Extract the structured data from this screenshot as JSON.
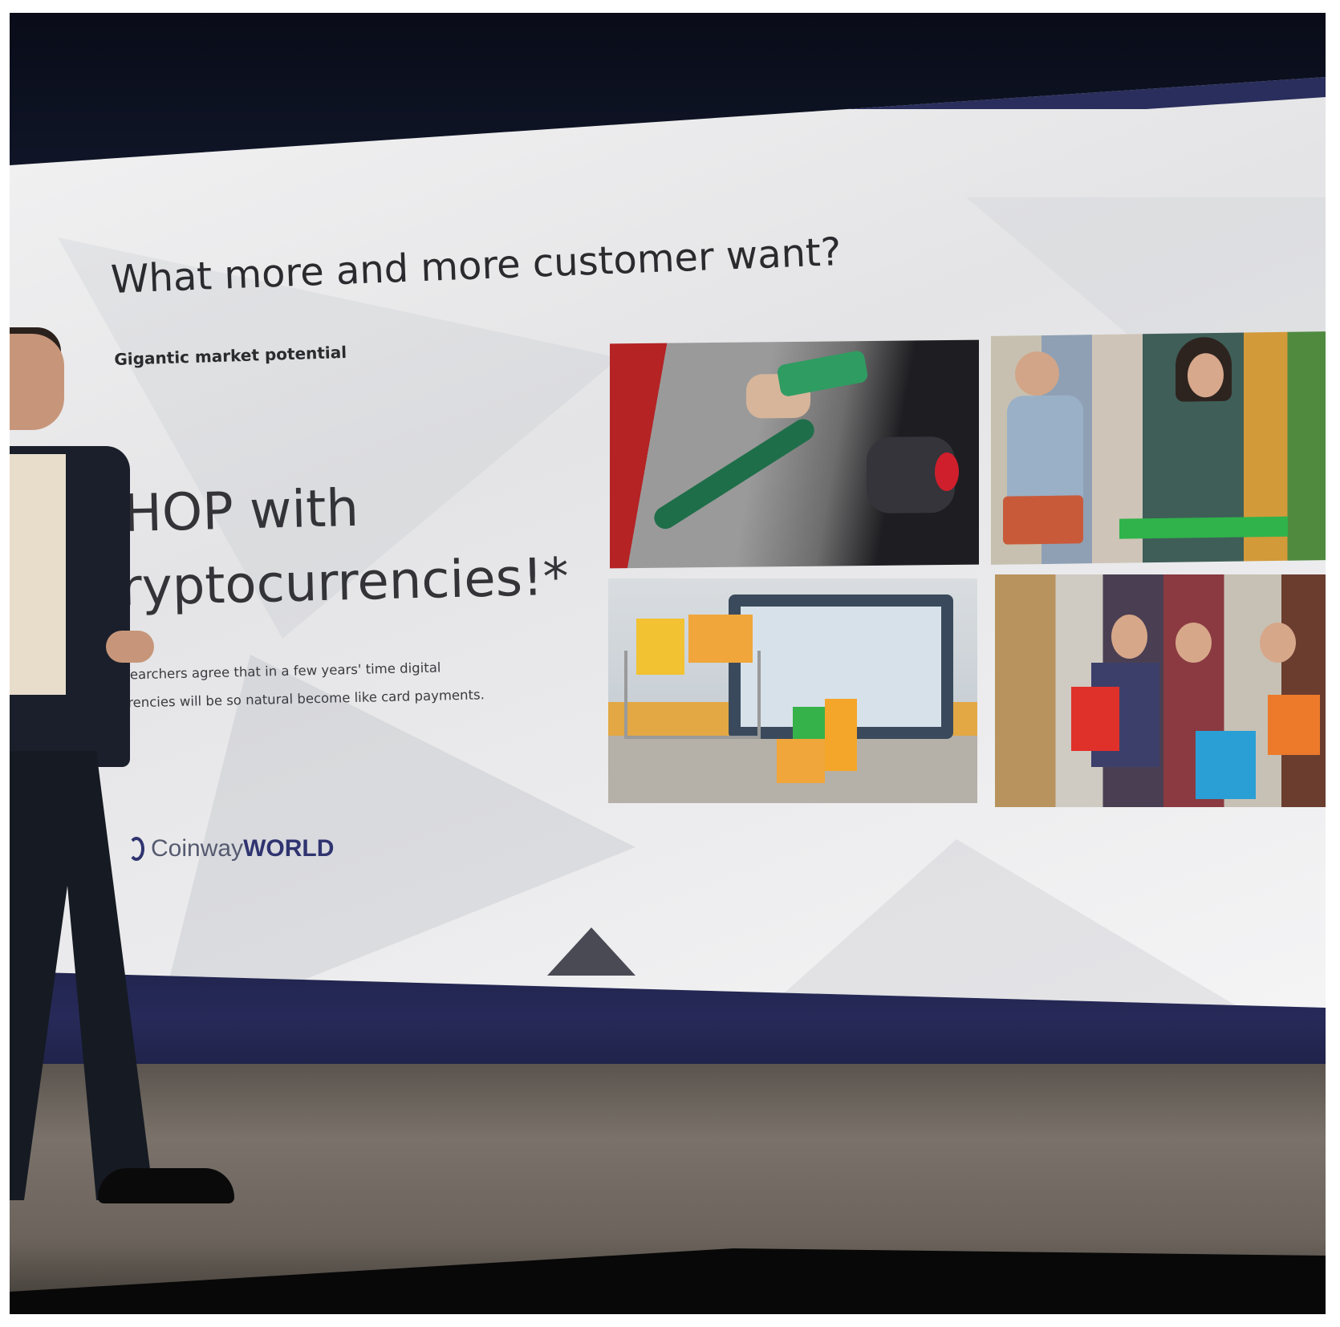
{
  "slide": {
    "title": "What more and more customer want?",
    "subtitle": "Gigantic market potential",
    "headline_line1": "SHOP with",
    "headline_line2": "cryptocurrencies!*",
    "body_line1": "Researchers agree that in a few years' time digital",
    "body_line2": "currencies will be so natural become like card payments.",
    "logo_part1": "Coinway",
    "logo_part2": "WORLD"
  },
  "images": [
    {
      "label": "fuel-pump-photo"
    },
    {
      "label": "grocery-shopping-photo"
    },
    {
      "label": "online-shopping-cart-photo"
    },
    {
      "label": "women-shopping-bags-photo"
    }
  ],
  "colors": {
    "screen_bg": "#ececee",
    "text": "#2b2b2f",
    "brand": "#2f3470",
    "wall_band": "#272a58",
    "stage": "#6c645c"
  }
}
